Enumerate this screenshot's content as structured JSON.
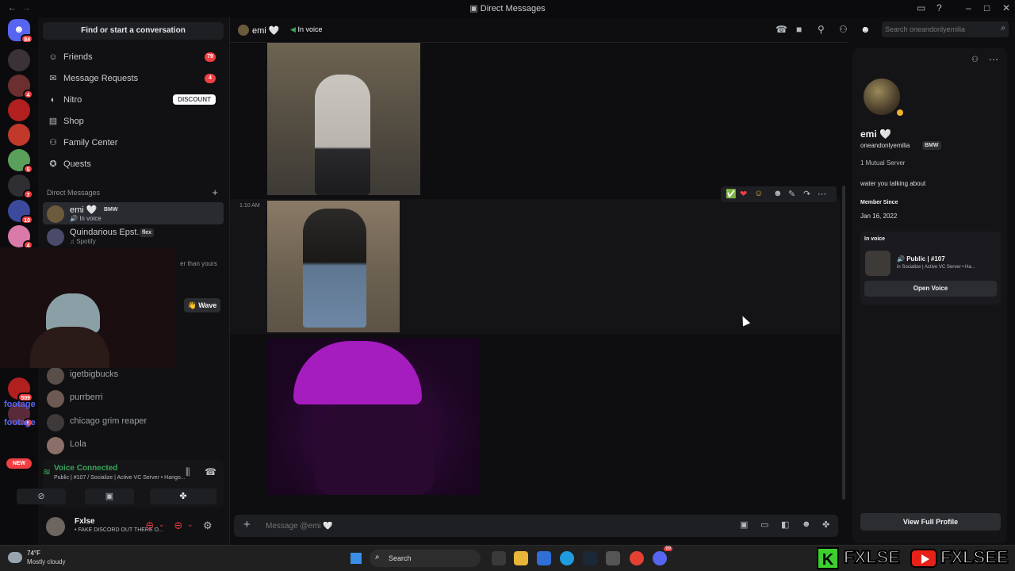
{
  "window": {
    "title": "Direct Messages"
  },
  "server_rail": {
    "home_badge": "84",
    "badges": [
      "4",
      "5",
      "7",
      "10",
      "4",
      "509",
      "5"
    ],
    "new_label": "NEW"
  },
  "sidebar": {
    "search_label": "Find or start a conversation",
    "nav": [
      {
        "label": "Friends",
        "count": "79"
      },
      {
        "label": "Message Requests",
        "count": "4"
      },
      {
        "label": "Nitro",
        "pill": "DISCOUNT"
      },
      {
        "label": "Shop"
      },
      {
        "label": "Family Center"
      },
      {
        "label": "Quests"
      }
    ],
    "dm_header": "Direct Messages",
    "dms": [
      {
        "name": "emi 🤍",
        "tag": "BMW",
        "sub": "In voice"
      },
      {
        "name": "Quindarious Epst.",
        "tag": "flex",
        "sub": "Spotify"
      },
      {
        "name": "igetbigbucks"
      },
      {
        "name": "purrberri"
      },
      {
        "name": "chicago grim reaper"
      },
      {
        "name": "Lola"
      }
    ],
    "cut_text": "er than yours",
    "wave_label": "Wave",
    "overlay_names": [
      "footage",
      "footage"
    ]
  },
  "voice_panel": {
    "title": "Voice Connected",
    "subtitle": "Public | #107 / Socialize | Active VC Server • Hango..."
  },
  "user_panel": {
    "name": "Fxlse",
    "status": "• FAKE DISCORD OUT THERE O..."
  },
  "chat": {
    "header_name": "emi 🤍",
    "header_status": "In voice",
    "search_placeholder": "Search oneandonlyemilia",
    "timestamp": "1:10 AM",
    "composer_placeholder": "Message @emi 🤍"
  },
  "profile": {
    "display_name": "emi 🤍",
    "username": "oneandonlyemilia",
    "tag": "BMW",
    "mutual": "1 Mutual Server",
    "bio": "water you talking about",
    "member_since_label": "Member Since",
    "member_since": "Jan 16, 2022",
    "in_voice_label": "In voice",
    "voice_channel": "Public | #107",
    "voice_server": "in Socialize | Active VC Server • Ha...",
    "open_voice": "Open Voice",
    "view_full": "View Full Profile"
  },
  "taskbar": {
    "temp": "74°F",
    "weather": "Mostly cloudy",
    "search": "Search",
    "discord_badge": "99"
  },
  "stream_overlay": {
    "text1": "FXLSE",
    "text2": "FXLSEE",
    "k": "K"
  },
  "colors": {
    "accent": "#5865f2",
    "danger": "#f23f42",
    "online": "#3ba55c"
  }
}
